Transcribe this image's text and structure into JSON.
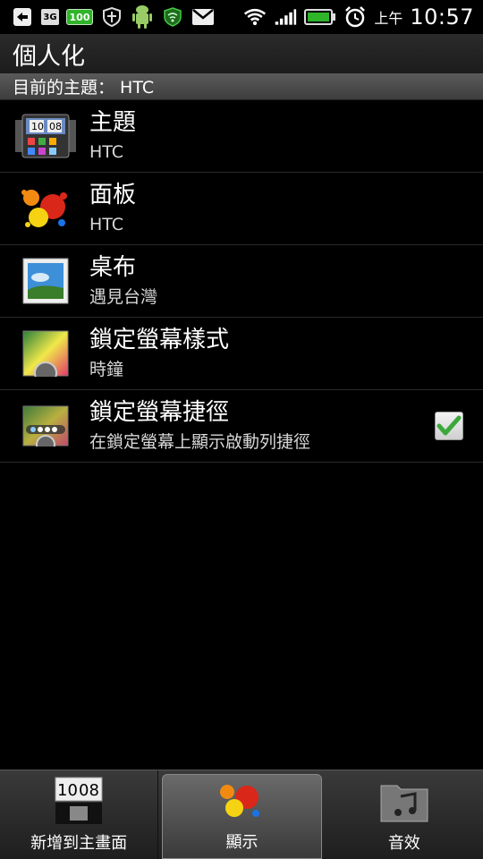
{
  "status_bar": {
    "left_icons": [
      "back-arrow-icon",
      "3g-badge-icon",
      "battery-100-badge-icon",
      "shield-icon",
      "android-icon",
      "wifi-shield-icon",
      "gmail-icon"
    ],
    "badge_3g": "3G",
    "badge_100": "100",
    "ampm": "上午",
    "time": "10:57",
    "accent_green": "#2fb42a"
  },
  "header": {
    "title": "個人化",
    "current_theme_label": "目前的主題： HTC"
  },
  "list": {
    "items": [
      {
        "primary": "主題",
        "secondary": "HTC",
        "icon": "theme-clock-icon"
      },
      {
        "primary": "面板",
        "secondary": "HTC",
        "icon": "skin-paint-splash-icon"
      },
      {
        "primary": "桌布",
        "secondary": "遇見台灣",
        "icon": "wallpaper-picture-icon"
      },
      {
        "primary": "鎖定螢幕樣式",
        "secondary": "時鐘",
        "icon": "lockscreen-style-icon"
      },
      {
        "primary": "鎖定螢幕捷徑",
        "secondary": "在鎖定螢幕上顯示啟動列捷徑",
        "icon": "lockscreen-shortcuts-icon",
        "checked": true
      }
    ]
  },
  "tabs": [
    {
      "label": "新增到主畫面",
      "icon": "add-to-home-clock-icon",
      "active": false
    },
    {
      "label": "顯示",
      "icon": "display-paint-splash-icon",
      "active": true
    },
    {
      "label": "音效",
      "icon": "sound-music-folder-icon",
      "active": false
    }
  ]
}
